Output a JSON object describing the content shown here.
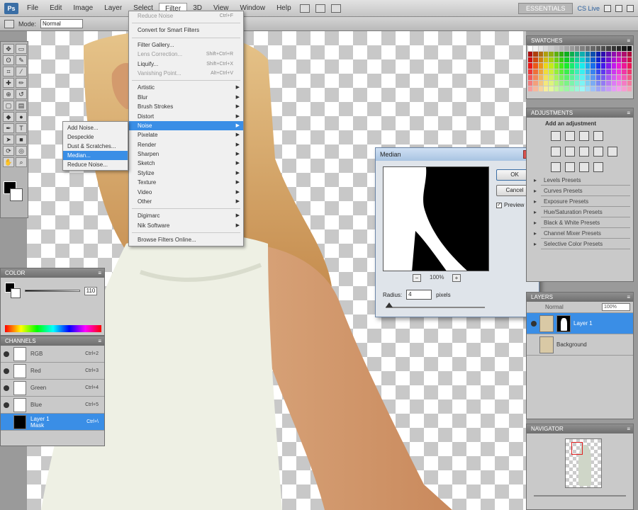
{
  "menubar": {
    "logo": "Ps",
    "items": [
      "File",
      "Edit",
      "Image",
      "Layer",
      "Select",
      "Filter",
      "3D",
      "View",
      "Window",
      "Help"
    ],
    "active": "Filter",
    "workspace": "ESSENTIALS",
    "zoom": "CS Live"
  },
  "options_bar": {
    "mode_label": "Mode:",
    "mode_value": "Normal"
  },
  "filter_menu": {
    "items": [
      {
        "label": "Reduce Noise",
        "shortcut": "Ctrl+F",
        "state": "disabled"
      },
      {
        "separator": true
      },
      {
        "label": "Convert for Smart Filters"
      },
      {
        "separator": true
      },
      {
        "label": "Filter Gallery..."
      },
      {
        "label": "Lens Correction...",
        "shortcut": "Shift+Ctrl+R",
        "state": "disabled"
      },
      {
        "label": "Liquify...",
        "shortcut": "Shift+Ctrl+X"
      },
      {
        "label": "Vanishing Point...",
        "shortcut": "Alt+Ctrl+V",
        "state": "disabled"
      },
      {
        "separator": true
      },
      {
        "label": "Artistic",
        "submenu": true
      },
      {
        "label": "Blur",
        "submenu": true
      },
      {
        "label": "Brush Strokes",
        "submenu": true
      },
      {
        "label": "Distort",
        "submenu": true
      },
      {
        "label": "Noise",
        "submenu": true,
        "state": "highlighted"
      },
      {
        "label": "Pixelate",
        "submenu": true
      },
      {
        "label": "Render",
        "submenu": true
      },
      {
        "label": "Sharpen",
        "submenu": true
      },
      {
        "label": "Sketch",
        "submenu": true
      },
      {
        "label": "Stylize",
        "submenu": true
      },
      {
        "label": "Texture",
        "submenu": true
      },
      {
        "label": "Video",
        "submenu": true
      },
      {
        "label": "Other",
        "submenu": true
      },
      {
        "separator": true
      },
      {
        "label": "Digimarc",
        "submenu": true
      },
      {
        "label": "Nik Software",
        "submenu": true
      },
      {
        "separator": true
      },
      {
        "label": "Browse Filters Online..."
      }
    ]
  },
  "noise_submenu": {
    "items": [
      {
        "label": "Add Noise..."
      },
      {
        "label": "Despeckle"
      },
      {
        "label": "Dust & Scratches..."
      },
      {
        "label": "Median...",
        "state": "highlighted"
      },
      {
        "label": "Reduce Noise..."
      }
    ]
  },
  "median_dialog": {
    "title": "Median",
    "ok": "OK",
    "cancel": "Cancel",
    "preview_label": "Preview",
    "preview_checked": true,
    "zoom": "100%",
    "radius_label": "Radius:",
    "radius_value": "4",
    "radius_unit": "pixels"
  },
  "color_panel": {
    "tab": "COLOR",
    "value": "110"
  },
  "channels_panel": {
    "tab": "CHANNELS",
    "rows": [
      {
        "name": "RGB",
        "shortcut": "Ctrl+2"
      },
      {
        "name": "Red",
        "shortcut": "Ctrl+3"
      },
      {
        "name": "Green",
        "shortcut": "Ctrl+4"
      },
      {
        "name": "Blue",
        "shortcut": "Ctrl+5"
      },
      {
        "name": "Layer 1 Mask",
        "shortcut": "Ctrl+\\",
        "selected": true
      }
    ]
  },
  "swatches_panel": {
    "tab": "SWATCHES"
  },
  "adjustments_panel": {
    "tab": "ADJUSTMENTS",
    "heading": "Add an adjustment",
    "presets": [
      "Levels Presets",
      "Curves Presets",
      "Exposure Presets",
      "Hue/Saturation Presets",
      "Black & White Presets",
      "Channel Mixer Presets",
      "Selective Color Presets"
    ]
  },
  "layers_panel": {
    "tab": "LAYERS",
    "blend": "Normal",
    "opacity": "100%",
    "rows": [
      {
        "name": "Layer 1",
        "selected": true,
        "mask": true
      },
      {
        "name": "Background"
      }
    ]
  },
  "navigator_panel": {
    "tab": "NAVIGATOR"
  },
  "colors": {
    "accent": "#3a8ee6",
    "canvas_check": "#c8c8c8"
  }
}
